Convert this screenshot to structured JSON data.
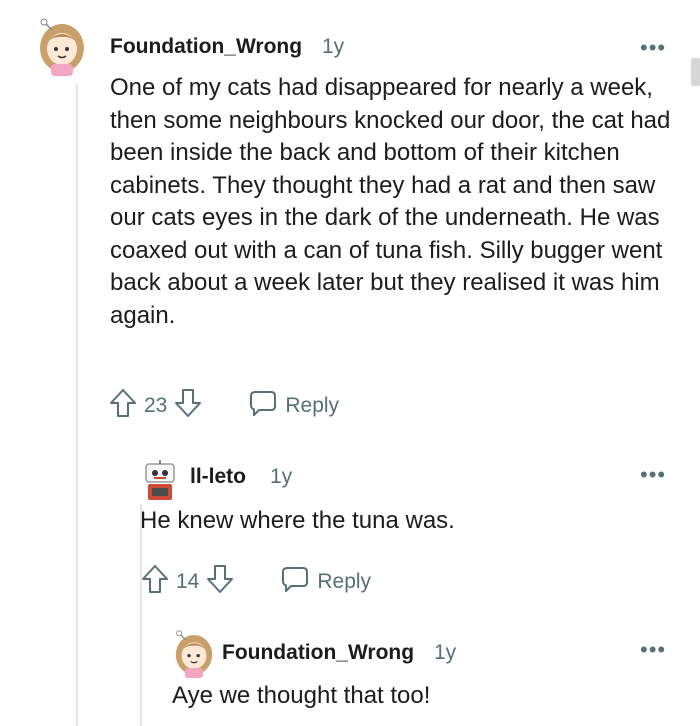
{
  "comments": [
    {
      "username": "Foundation_Wrong",
      "age": "1y",
      "more": "•••",
      "body": "One of my cats had disappeared for nearly a week, then some neighbours knocked our door, the cat had been inside the back and bottom of their kitchen cabinets. They thought they had a rat and then saw our cats eyes in the dark of the underneath. He was coaxed out with a can of tuna fish. Silly bugger went back about a week later but they realised it was him again.",
      "votes": "23",
      "reply_label": "Reply"
    },
    {
      "username": "ll-leto",
      "age": "1y",
      "more": "•••",
      "body": "He knew where the tuna was.",
      "votes": "14",
      "reply_label": "Reply"
    },
    {
      "username": "Foundation_Wrong",
      "age": "1y",
      "more": "•••",
      "body": "Aye we thought that too!"
    }
  ],
  "icons": {
    "upvote": "arrow-up-icon",
    "downvote": "arrow-down-icon",
    "reply": "speech-bubble-icon",
    "more": "ellipsis-icon"
  }
}
